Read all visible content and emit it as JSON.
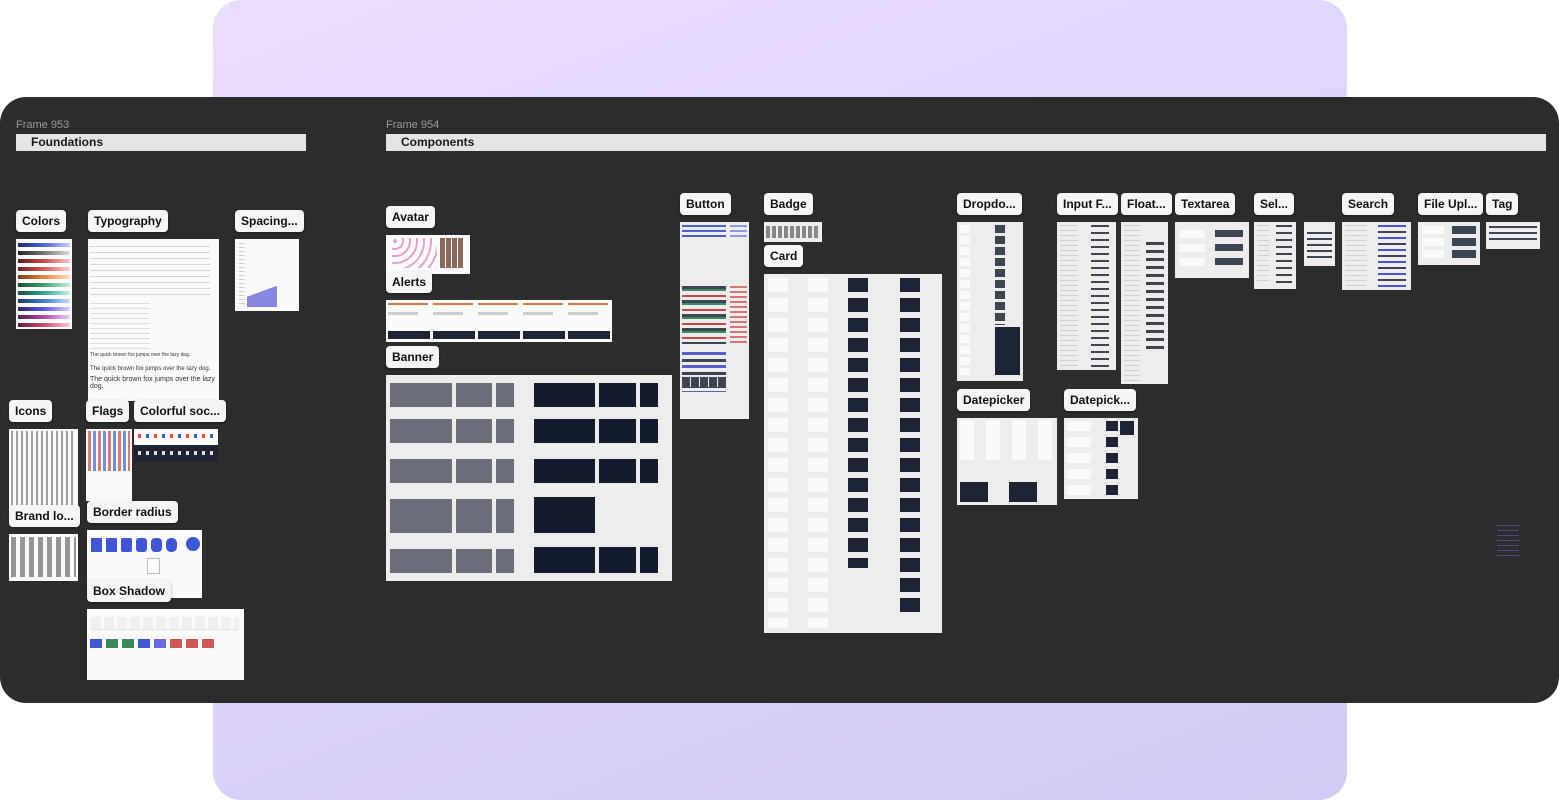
{
  "frames": [
    {
      "name": "Frame 953",
      "section": "Foundations"
    },
    {
      "name": "Frame 954",
      "section": "Components"
    }
  ],
  "foundations": {
    "colors": "Colors",
    "typography": "Typography",
    "spacing": "Spacing...",
    "icons": "Icons",
    "flags": "Flags",
    "colorful_social": "Colorful soc...",
    "brand_logos": "Brand lo...",
    "border_radius": "Border radius",
    "box_shadow": "Box Shadow"
  },
  "typography_samples": [
    "The quick brown fox jumps over the lazy dog.",
    "The quick brown fox jumps over the lazy dog.",
    "The quick brown fox jumps over the lazy dog."
  ],
  "components": {
    "avatar": "Avatar",
    "alerts": "Alerts",
    "banner": "Banner",
    "button": "Button",
    "badge": "Badge",
    "card": "Card",
    "dropdown": "Dropdo...",
    "input_field": "Input F...",
    "floating": "Float...",
    "textarea": "Textarea",
    "select": "Sel...",
    "search": "Search",
    "file_upload": "File Upl...",
    "tag": "Tag",
    "datepicker": "Datepicker",
    "datepicker2": "Datepick..."
  },
  "colors": {
    "canvas": "#2c2c2c",
    "accent": "#3f57d6",
    "dark_panel": "#151b2b"
  }
}
